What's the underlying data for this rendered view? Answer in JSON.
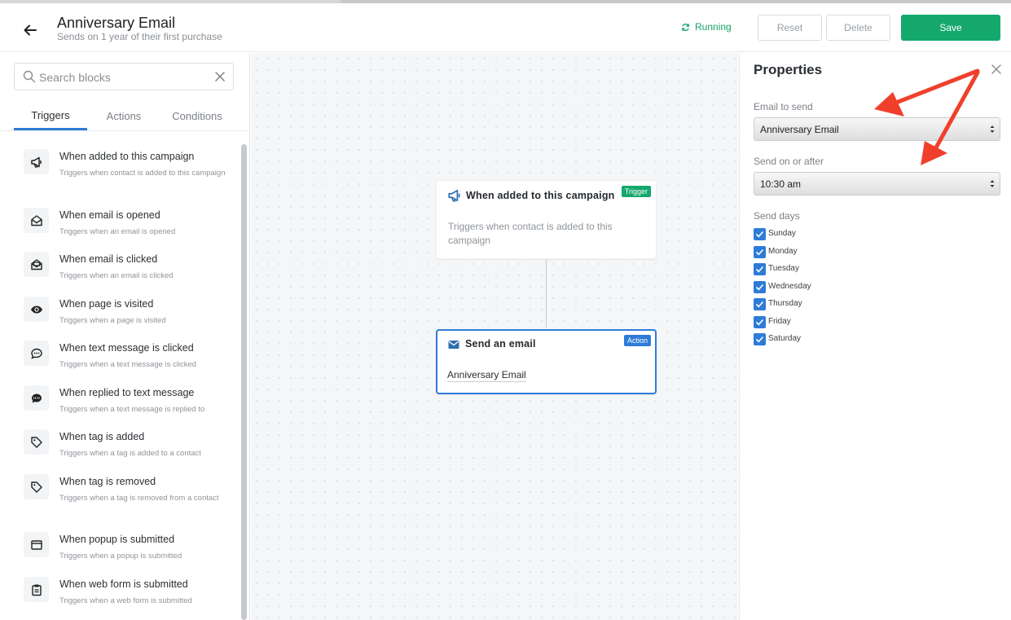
{
  "header": {
    "title": "Anniversary Email",
    "subtitle": "Sends on 1 year of their first purchase",
    "status": "Running",
    "reset_label": "Reset",
    "delete_label": "Delete",
    "save_label": "Save"
  },
  "sidebar": {
    "search_placeholder": "Search blocks",
    "tabs": [
      "Triggers",
      "Actions",
      "Conditions"
    ],
    "active_tab": "Triggers",
    "items": [
      {
        "title": "When added to this campaign",
        "desc": "Triggers when contact is added to this campaign",
        "icon": "megaphone-icon"
      },
      {
        "title": "When email is opened",
        "desc": "Triggers when an email is opened",
        "icon": "envelope-open-icon"
      },
      {
        "title": "When email is clicked",
        "desc": "Triggers when an email is clicked",
        "icon": "envelope-clicked-icon"
      },
      {
        "title": "When page is visited",
        "desc": "Triggers when a page is visited",
        "icon": "eye-icon"
      },
      {
        "title": "When text message is clicked",
        "desc": "Triggers when a text message is clicked",
        "icon": "chat-bubble-icon"
      },
      {
        "title": "When replied to text message",
        "desc": "Triggers when a text message is replied to",
        "icon": "sms-bubble-icon"
      },
      {
        "title": "When tag is added",
        "desc": "Triggers when a tag is added to a contact",
        "icon": "tag-icon"
      },
      {
        "title": "When tag is removed",
        "desc": "Triggers when a tag is removed from a contact",
        "icon": "tag-icon"
      },
      {
        "title": "When popup is submitted",
        "desc": "Triggers when a popup is submitted",
        "icon": "browser-window-icon"
      },
      {
        "title": "When web form is submitted",
        "desc": "Triggers when a web form is submitted",
        "icon": "clipboard-icon"
      }
    ]
  },
  "canvas": {
    "trigger_node": {
      "title": "When added to this campaign",
      "badge": "Trigger",
      "desc": "Triggers when contact is added to this campaign"
    },
    "action_node": {
      "title": "Send an email",
      "badge": "Action",
      "desc": "Anniversary Email"
    }
  },
  "properties": {
    "title": "Properties",
    "email_label": "Email to send",
    "email_value": "Anniversary Email",
    "send_on_label": "Send on or after",
    "send_on_value": "10:30 am",
    "send_days_label": "Send days",
    "days": [
      {
        "label": "Sunday",
        "checked": true
      },
      {
        "label": "Monday",
        "checked": true
      },
      {
        "label": "Tuesday",
        "checked": true
      },
      {
        "label": "Wednesday",
        "checked": true
      },
      {
        "label": "Thursday",
        "checked": true
      },
      {
        "label": "Friday",
        "checked": true
      },
      {
        "label": "Saturday",
        "checked": true
      }
    ]
  },
  "colors": {
    "accent": "#2f7bd8",
    "save": "#15a86c",
    "annotation": "#f0402c"
  }
}
